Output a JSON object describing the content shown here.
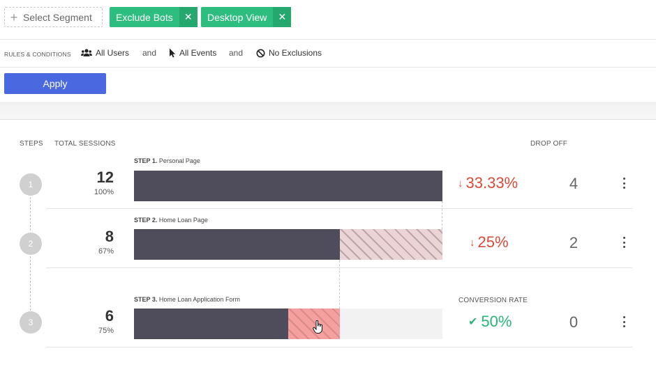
{
  "segments": {
    "select_label": "Select Segment",
    "chips": [
      {
        "label": "Exclude Bots"
      },
      {
        "label": "Desktop View"
      }
    ]
  },
  "rules": {
    "title": "RULES & CONDITIONS",
    "users": "All Users",
    "and_1": "and",
    "events": "All Events",
    "and_2": "and",
    "exclusions": "No Exclusions"
  },
  "apply_label": "Apply",
  "funnel": {
    "headers": {
      "steps": "STEPS",
      "total_sessions": "TOTAL SESSIONS",
      "drop_off": "DROP OFF",
      "conversion_rate": "CONVERSION RATE"
    },
    "steps": [
      {
        "number": "1",
        "step_prefix": "STEP 1.",
        "name": "Personal Page",
        "sessions": "12",
        "sessions_pct": "100%",
        "rate": "33.33%",
        "count": "4"
      },
      {
        "number": "2",
        "step_prefix": "STEP 2.",
        "name": "Home Loan Page",
        "sessions": "8",
        "sessions_pct": "67%",
        "rate": "25%",
        "count": "2"
      },
      {
        "number": "3",
        "step_prefix": "STEP 3.",
        "name": "Home Loan Application Form",
        "sessions": "6",
        "sessions_pct": "75%",
        "rate": "50%",
        "count": "0"
      }
    ]
  },
  "colors": {
    "chip_green": "#2dbd7e",
    "apply_blue": "#4a68e0",
    "bar_dark": "#4f4d5b",
    "drop_red": "#d64a3a",
    "conversion_green": "#27b577"
  },
  "icons": {
    "plus": "plus-icon",
    "chip_close": "close-icon",
    "users": "users-icon",
    "events": "cursor-pointer-icon",
    "exclusions": "ban-icon",
    "drop_arrow": "arrow-down-icon",
    "conversion": "check-icon",
    "menu": "kebab-menu-icon"
  }
}
